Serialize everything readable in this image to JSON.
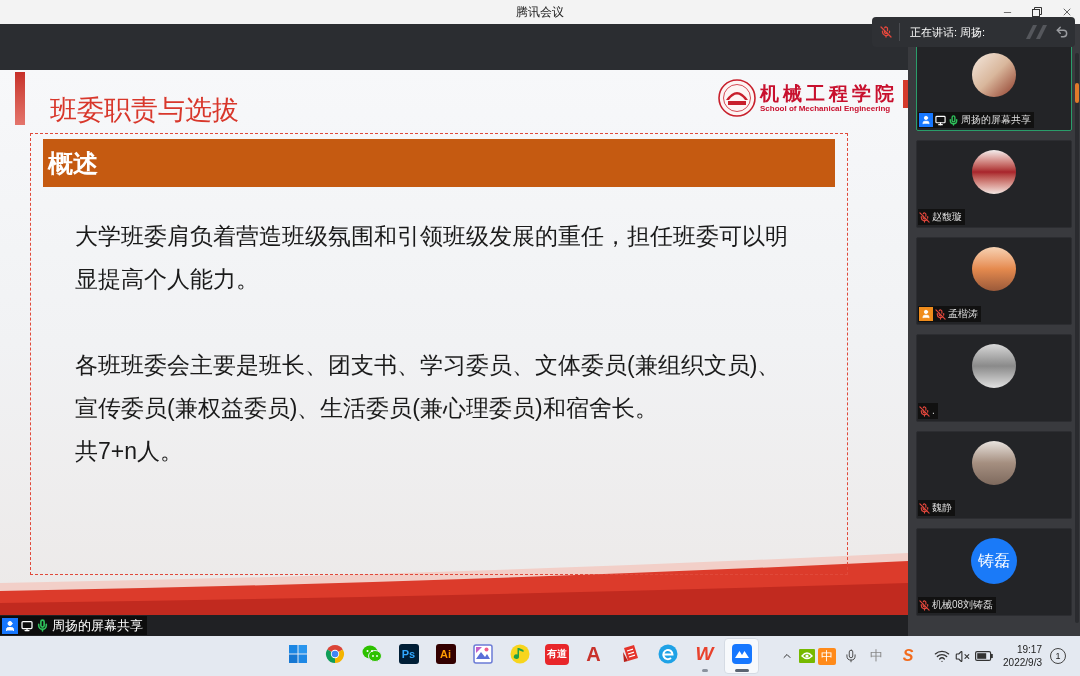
{
  "window": {
    "title": "腾讯会议"
  },
  "speaking_banner": {
    "label": "正在讲话: 周扬:"
  },
  "slide": {
    "title": "班委职责与选拔",
    "logo": {
      "name": "机械工程学院",
      "subtitle": "School of Mechanical Engineering"
    },
    "section": {
      "heading": "概述",
      "paragraphs": [
        [
          "大学班委肩负着营造班级氛围和引领班级发展的重任，担任班委可以明显提高个人能力。"
        ],
        [
          "各班班委会主要是班长、团支书、学习委员、文体委员(兼组织文员)、宣传委员(兼权益委员)、生活委员(兼心理委员)和宿舍长。",
          "共7+n人。"
        ]
      ]
    }
  },
  "screen_share_label": {
    "name": "周扬的屏幕共享",
    "badge": {
      "color": "#1677ff"
    },
    "screen_sharing": true,
    "muted": false
  },
  "participants": [
    {
      "name": "周扬的屏幕共享",
      "badge": {
        "color": "#1677ff"
      },
      "screen_sharing": true,
      "muted": false,
      "speaking": true,
      "avatar": {
        "kind": "photo"
      }
    },
    {
      "name": "赵馥璇",
      "screen_sharing": false,
      "muted": true,
      "speaking": false,
      "avatar": {
        "kind": "photo"
      }
    },
    {
      "name": "孟楷涛",
      "badge": {
        "color": "#f08c1c"
      },
      "screen_sharing": false,
      "muted": true,
      "speaking": false,
      "avatar": {
        "kind": "photo"
      }
    },
    {
      "name": ".",
      "screen_sharing": false,
      "muted": true,
      "speaking": false,
      "avatar": {
        "kind": "photo"
      }
    },
    {
      "name": "魏静",
      "screen_sharing": false,
      "muted": true,
      "speaking": false,
      "avatar": {
        "kind": "photo"
      }
    },
    {
      "name": "机械08刘铸磊",
      "screen_sharing": false,
      "muted": true,
      "speaking": false,
      "avatar": {
        "kind": "initials",
        "text": "铸磊"
      }
    }
  ],
  "taskbar": {
    "apps": [
      {
        "kind": "start",
        "running": false,
        "selected": false
      },
      {
        "kind": "browser",
        "running": false,
        "selected": false
      },
      {
        "kind": "chat",
        "running": false,
        "selected": false
      },
      {
        "kind": "ps",
        "label": "Ps",
        "running": false,
        "selected": false
      },
      {
        "kind": "ai",
        "label": "Ai",
        "running": false,
        "selected": false
      },
      {
        "kind": "picture",
        "running": false,
        "selected": false
      },
      {
        "kind": "music",
        "running": false,
        "selected": false
      },
      {
        "kind": "dict",
        "label": "有道",
        "running": false,
        "selected": false
      },
      {
        "kind": "letter",
        "label": "A",
        "running": false,
        "selected": false
      },
      {
        "kind": "document",
        "running": false,
        "selected": false
      },
      {
        "kind": "ring",
        "running": false,
        "selected": false
      },
      {
        "kind": "wletter",
        "label": "W",
        "running": true,
        "selected": false
      },
      {
        "kind": "meeting",
        "running": true,
        "selected": true
      }
    ],
    "tray": [
      {
        "kind": "chevron"
      },
      {
        "kind": "gpu"
      },
      {
        "kind": "ime-tile",
        "label": "中"
      },
      {
        "kind": "mic"
      },
      {
        "kind": "ime-text",
        "label": "中"
      },
      {
        "kind": "logo-tile",
        "label": "S"
      },
      {
        "kind": "wifi"
      },
      {
        "kind": "volume-muted"
      },
      {
        "kind": "battery"
      }
    ],
    "clock": {
      "time": "19:17",
      "date": "2022/9/3"
    },
    "notifications": "1"
  }
}
